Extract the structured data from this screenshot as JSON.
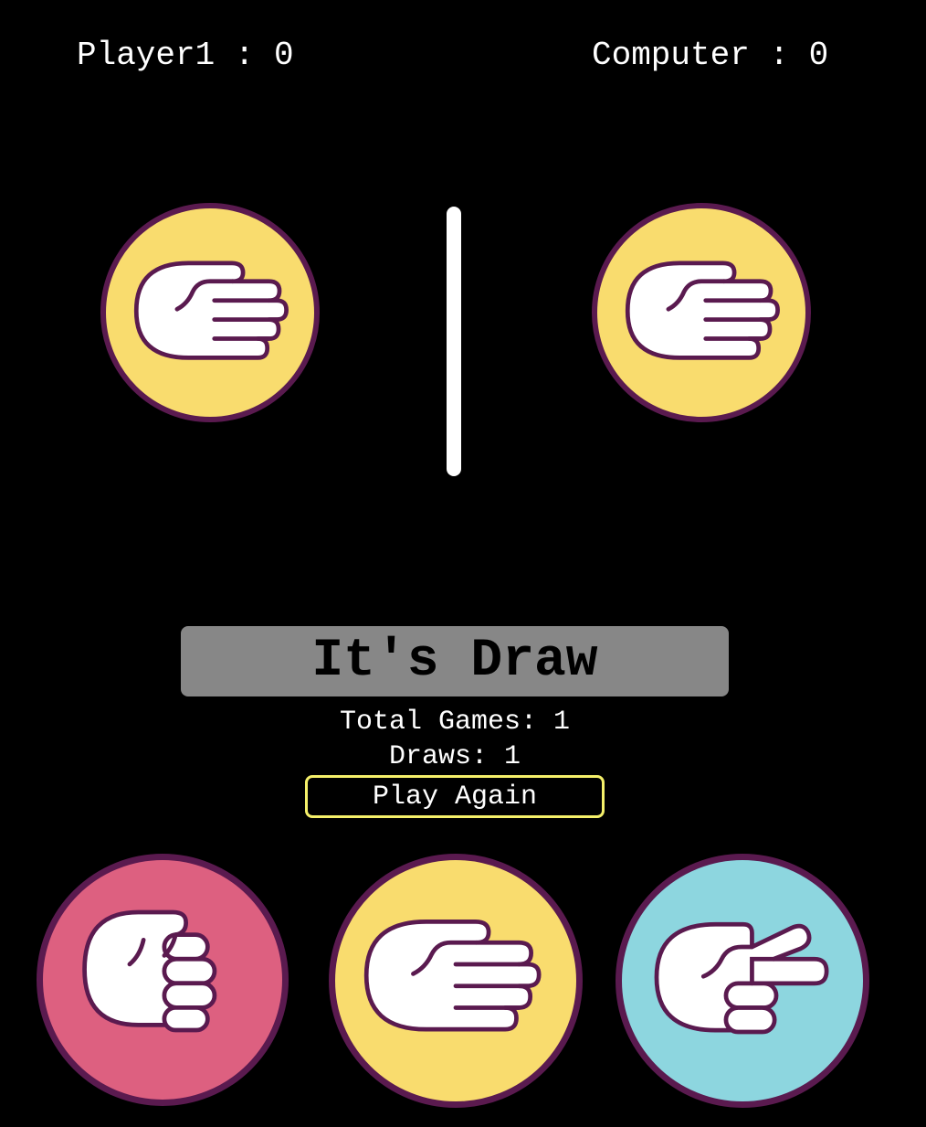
{
  "scoreboard": {
    "player_label": "Player1 : 0",
    "computer_label": "Computer : 0"
  },
  "round": {
    "player_choice_icon": "paper-hand-icon",
    "computer_choice_icon": "paper-hand-icon",
    "result_text": "It's Draw"
  },
  "stats": {
    "total_games": "Total Games: 1",
    "draws": "Draws: 1"
  },
  "actions": {
    "play_again_label": "Play Again"
  },
  "choices": [
    {
      "icon": "rock-hand-icon",
      "color": "#dd6080"
    },
    {
      "icon": "paper-hand-icon",
      "color": "#f9dc6e"
    },
    {
      "icon": "scissors-hand-icon",
      "color": "#8dd6df"
    }
  ],
  "colors": {
    "background": "#000000",
    "circle_border": "#5a1a4f",
    "hand_outline": "#5a1a4f",
    "result_banner": "#878787",
    "play_again_border": "#f5f06a"
  }
}
